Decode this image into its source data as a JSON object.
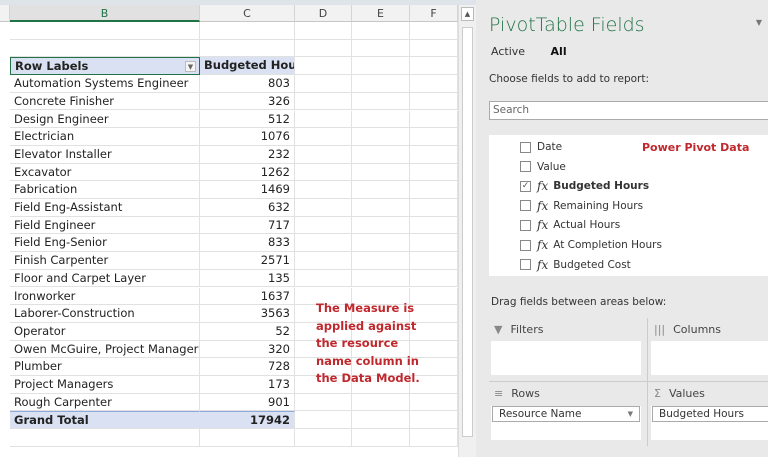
{
  "sheet": {
    "columns": [
      "B",
      "C",
      "D",
      "E",
      "F"
    ],
    "header": {
      "row_labels": "Row Labels",
      "value": "Budgeted Hours"
    },
    "rows": [
      {
        "label": "Automation Systems Engineer",
        "value": "803"
      },
      {
        "label": "Concrete Finisher",
        "value": "326"
      },
      {
        "label": "Design Engineer",
        "value": "512"
      },
      {
        "label": "Electrician",
        "value": "1076"
      },
      {
        "label": "Elevator Installer",
        "value": "232"
      },
      {
        "label": "Excavator",
        "value": "1262"
      },
      {
        "label": "Fabrication",
        "value": "1469"
      },
      {
        "label": "Field Eng-Assistant",
        "value": "632"
      },
      {
        "label": "Field Engineer",
        "value": "717"
      },
      {
        "label": "Field Eng-Senior",
        "value": "833"
      },
      {
        "label": "Finish Carpenter",
        "value": "2571"
      },
      {
        "label": "Floor and Carpet Layer",
        "value": "135"
      },
      {
        "label": "Ironworker",
        "value": "1637"
      },
      {
        "label": "Laborer-Construction",
        "value": "3563"
      },
      {
        "label": "Operator",
        "value": "52"
      },
      {
        "label": "Owen McGuire, Project Manager",
        "value": "320"
      },
      {
        "label": "Plumber",
        "value": "728"
      },
      {
        "label": "Project Managers",
        "value": "173"
      },
      {
        "label": "Rough Carpenter",
        "value": "901"
      }
    ],
    "total": {
      "label": "Grand Total",
      "value": "17942"
    },
    "note": "The Measure is applied against the resource name column in the Data Model."
  },
  "pane": {
    "title": "PivotTable Fields",
    "tabs": [
      "Active",
      "All"
    ],
    "choose": "Choose fields to add to report:",
    "search_placeholder": "Search",
    "annotation": "Power Pivot Data",
    "fields": [
      {
        "label": "Date",
        "checked": false,
        "measure": false
      },
      {
        "label": "Value",
        "checked": false,
        "measure": false
      },
      {
        "label": "Budgeted Hours",
        "checked": true,
        "measure": true
      },
      {
        "label": "Remaining Hours",
        "checked": false,
        "measure": true
      },
      {
        "label": "Actual Hours",
        "checked": false,
        "measure": true
      },
      {
        "label": "At Completion Hours",
        "checked": false,
        "measure": true
      },
      {
        "label": "Budgeted Cost",
        "checked": false,
        "measure": true
      }
    ],
    "drag_label": "Drag fields between areas below:",
    "areas": {
      "filters": "Filters",
      "columns": "Columns",
      "rows": "Rows",
      "values": "Values"
    },
    "rows_field": "Resource Name",
    "values_field": "Budgeted Hours"
  }
}
